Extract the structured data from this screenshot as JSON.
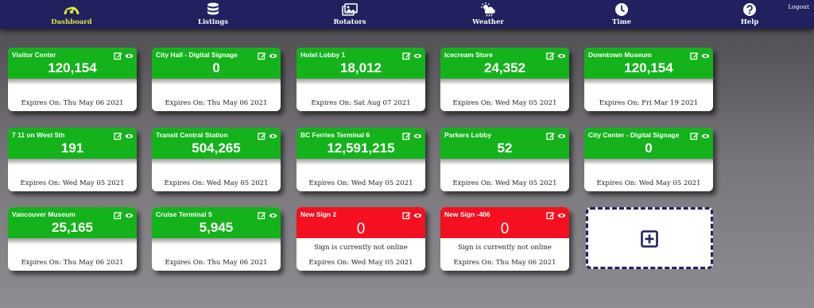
{
  "nav": {
    "items": [
      {
        "label": "Dashboard",
        "icon": "gauge-icon",
        "active": true
      },
      {
        "label": "Listings",
        "icon": "database-icon"
      },
      {
        "label": "Rotators",
        "icon": "images-icon"
      },
      {
        "label": "Weather",
        "icon": "cloud-sun-rain-icon"
      },
      {
        "label": "Time",
        "icon": "clock-icon"
      },
      {
        "label": "Help",
        "icon": "question-circle-icon"
      }
    ],
    "logout": "Logout"
  },
  "colors": {
    "nav_bg": "#20215e",
    "active_nav": "#dfe63a",
    "online": "#14b31c",
    "offline": "#f4101e"
  },
  "signs": [
    {
      "name": "Visitor Center",
      "count": "120,154",
      "expires": "Expires On: Thu May 06 2021",
      "online": true
    },
    {
      "name": "City Hall - Digital Signage",
      "count": "0",
      "expires": "Expires On: Thu May 06 2021",
      "online": true
    },
    {
      "name": "Hotel Lobby 1",
      "count": "18,012",
      "expires": "Expires On: Sat Aug 07 2021",
      "online": true
    },
    {
      "name": "Icecream Store",
      "count": "24,352",
      "expires": "Expires On: Wed May 05 2021",
      "online": true
    },
    {
      "name": "Downtown Museum",
      "count": "120,154",
      "expires": "Expires On: Fri Mar 19 2021",
      "online": true
    },
    {
      "name": "7 11 on West 5th",
      "count": "191",
      "expires": "Expires On: Wed May 05 2021",
      "online": true
    },
    {
      "name": "Transit Central Station",
      "count": "504,265",
      "expires": "Expires On: Wed May 05 2021",
      "online": true
    },
    {
      "name": "BC Ferries Terminal 6",
      "count": "12,591,215",
      "expires": "Expires On: Wed May 05 2021",
      "online": true
    },
    {
      "name": "Parkers Lobby",
      "count": "52",
      "expires": "Expires On: Wed May 05 2021",
      "online": true
    },
    {
      "name": "City Center - Digital Signage",
      "count": "0",
      "expires": "Expires On: Wed May 05 2021",
      "online": true
    },
    {
      "name": "Vancouver Museum",
      "count": "25,165",
      "expires": "Expires On: Thu May 06 2021",
      "online": true
    },
    {
      "name": "Cruise Terminal 5",
      "count": "5,945",
      "expires": "Expires On: Thu May 06 2021",
      "online": true
    },
    {
      "name": "New Sign 2",
      "count": "0",
      "status": "Sign is currently not online",
      "expires": "Expires On: Wed May 05 2021",
      "online": false
    },
    {
      "name": "New Sign -406",
      "count": "0",
      "status": "Sign is currently not online",
      "expires": "Expires On: Thu May 06 2021",
      "online": false
    }
  ],
  "add_card": {
    "icon": "plus-square-icon"
  }
}
